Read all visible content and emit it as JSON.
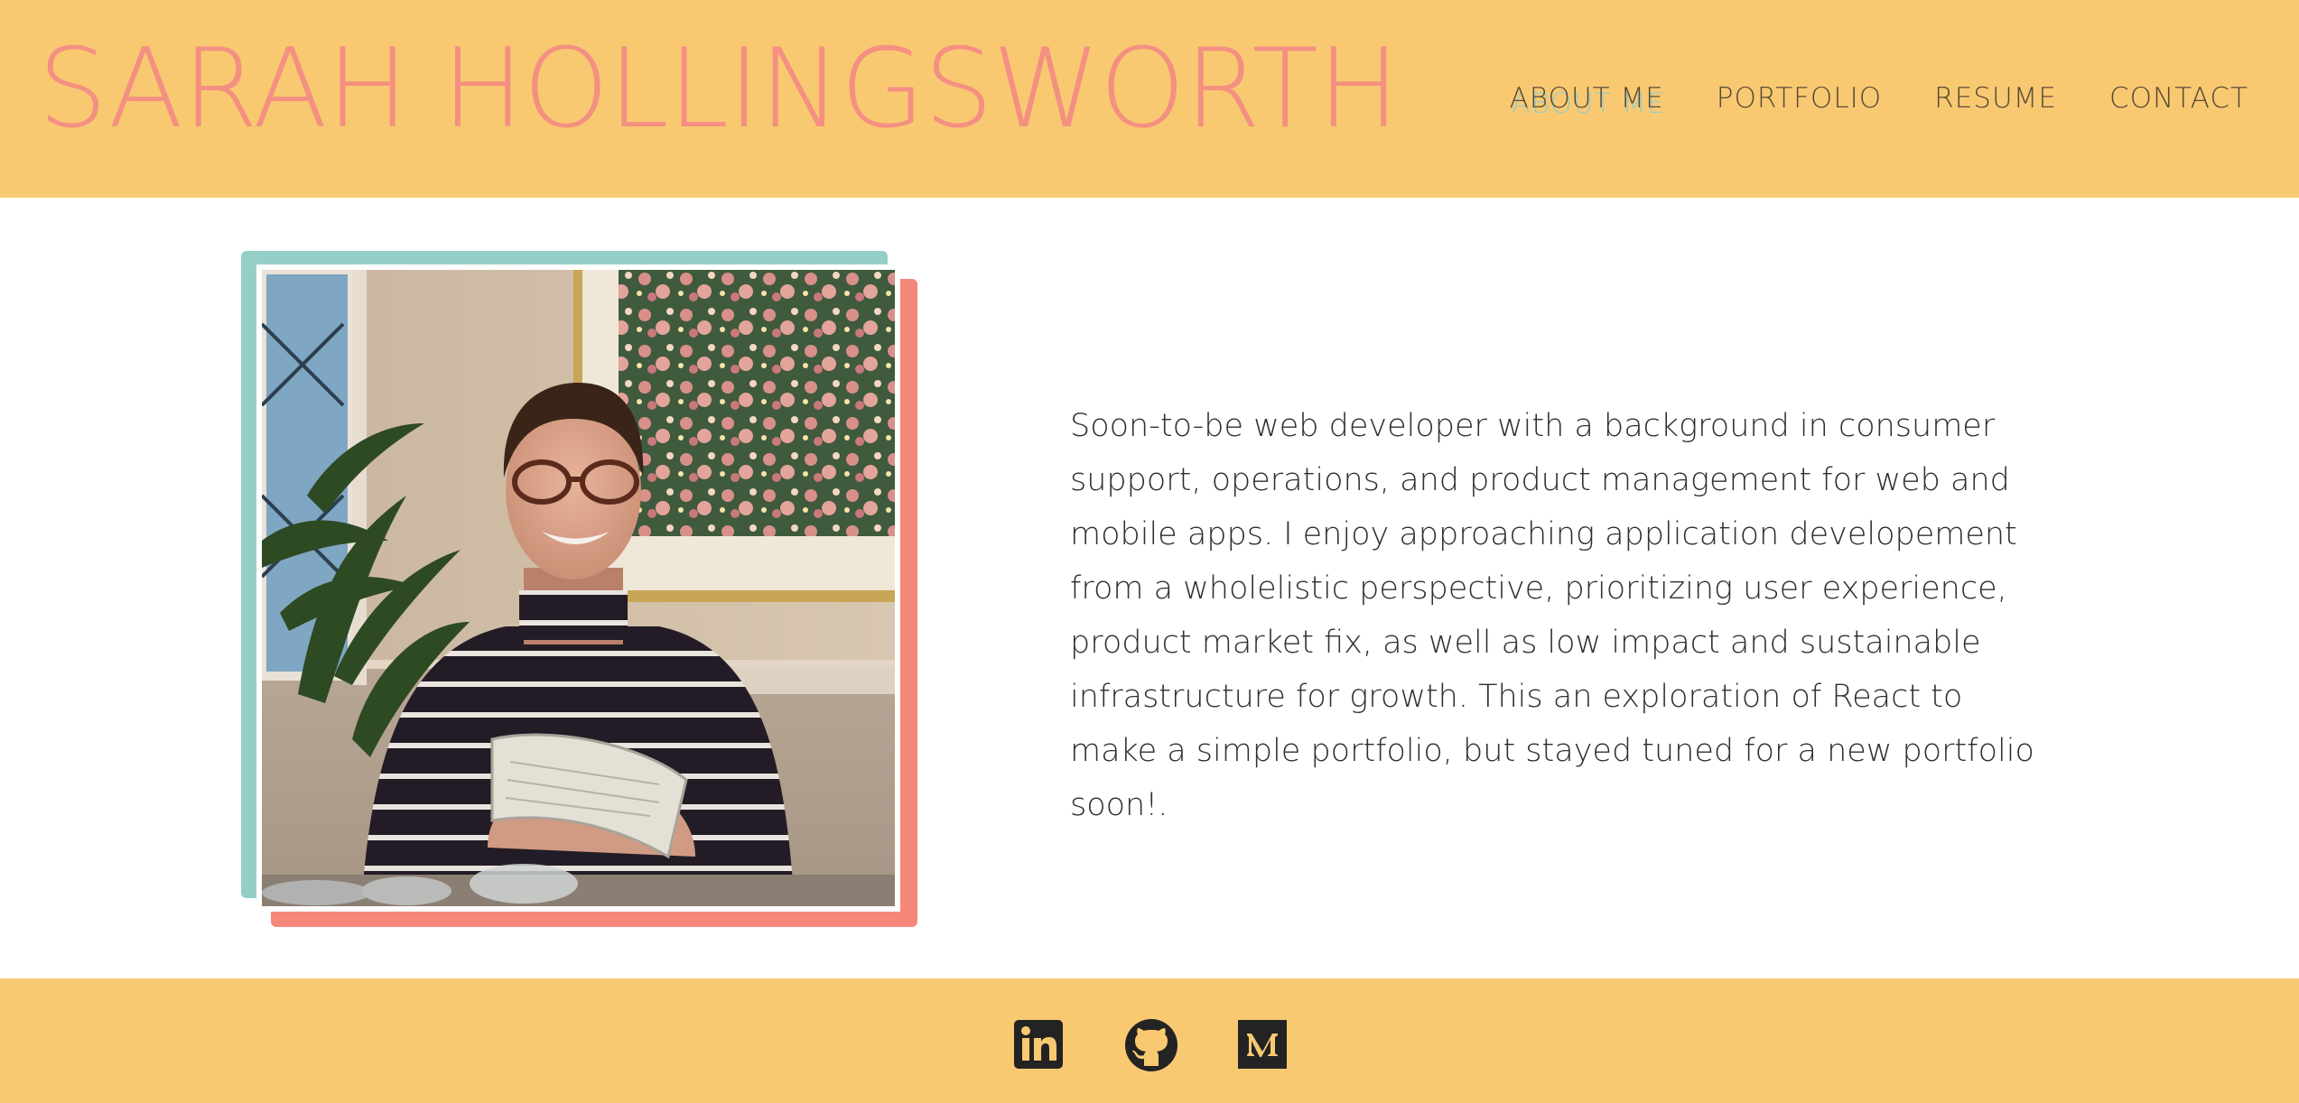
{
  "header": {
    "title": "SARAH HOLLINGSWORTH",
    "nav": [
      {
        "label": "ABOUT ME",
        "active": true
      },
      {
        "label": "PORTFOLIO",
        "active": false
      },
      {
        "label": "RESUME",
        "active": false
      },
      {
        "label": "CONTACT",
        "active": false
      }
    ]
  },
  "about": {
    "photo_alt": "portrait photo",
    "bio": "Soon-to-be web developer with a background in consumer support, operations, and product management for web and mobile apps. I enjoy approaching application developement from a wholelistic perspective, prioritizing user experience, product market fix, as well as low impact and sustainable infrastructure for growth. This an exploration of React to make a simple portfolio, but stayed tuned for a new portfolio soon!."
  },
  "footer": {
    "links": [
      {
        "icon": "linkedin-icon"
      },
      {
        "icon": "github-icon"
      },
      {
        "icon": "medium-icon"
      }
    ]
  },
  "colors": {
    "header_bg": "#f9c972",
    "title": "#f49082",
    "nav_text": "#5a4a38",
    "nav_active_accent": "#8ccfcb",
    "frame_teal": "#93cfc7",
    "frame_coral": "#f4877a",
    "icon": "#232323"
  }
}
